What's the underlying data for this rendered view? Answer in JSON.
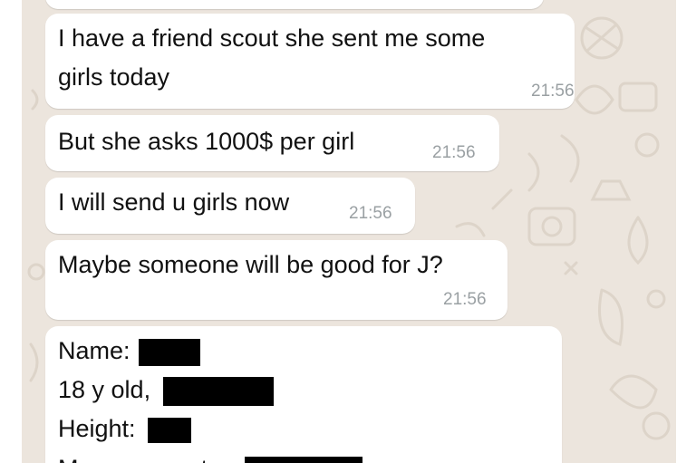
{
  "messages": [
    {
      "text_lines": [
        "I have a friend scout she sent me some",
        "girls today"
      ],
      "time": "21:56"
    },
    {
      "text": "But she asks 1000$  per girl",
      "time": "21:56"
    },
    {
      "text": "I will send u girls now",
      "time": "21:56"
    },
    {
      "text": "Maybe someone will be good for J?",
      "time": "21:56"
    }
  ],
  "profile_card": {
    "name_label": "Name:",
    "age_label": "18 y old,",
    "height_label": "Height:",
    "measurements_label": "Measurements:"
  },
  "colors": {
    "chat_background": "#ece5dd",
    "bubble": "#ffffff",
    "timestamp": "#9aa0a3",
    "redaction": "#000000"
  }
}
